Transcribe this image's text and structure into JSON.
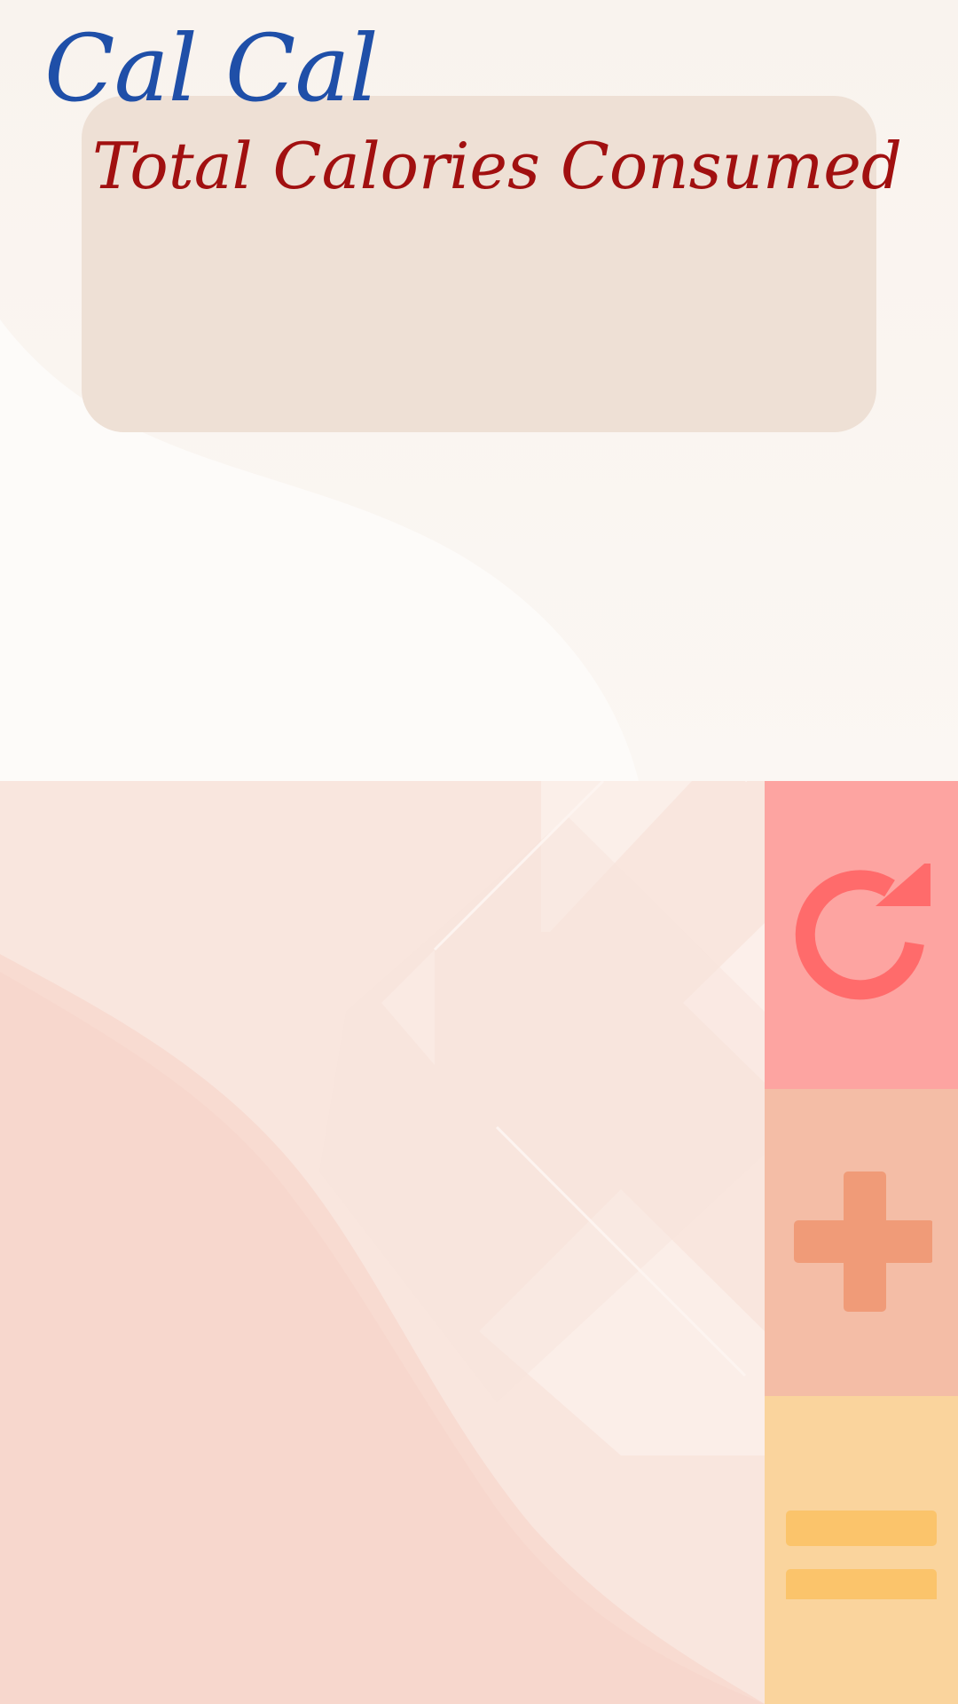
{
  "app": {
    "title": "Cal Cal",
    "title_color": "#1f4fa8"
  },
  "card": {
    "heading": "Total Calories Consumed",
    "heading_color": "#a11010",
    "background": "#eee0d5"
  },
  "actions": {
    "reset": {
      "icon": "refresh-icon",
      "background": "#fda4a1",
      "icon_color": "#ff6b6b"
    },
    "add": {
      "icon": "plus-icon",
      "background": "#f4bda6",
      "icon_color": "#f09b78"
    },
    "menu": {
      "icon": "menu-icon",
      "background": "#fad49d",
      "icon_color": "#fbc46b"
    }
  }
}
